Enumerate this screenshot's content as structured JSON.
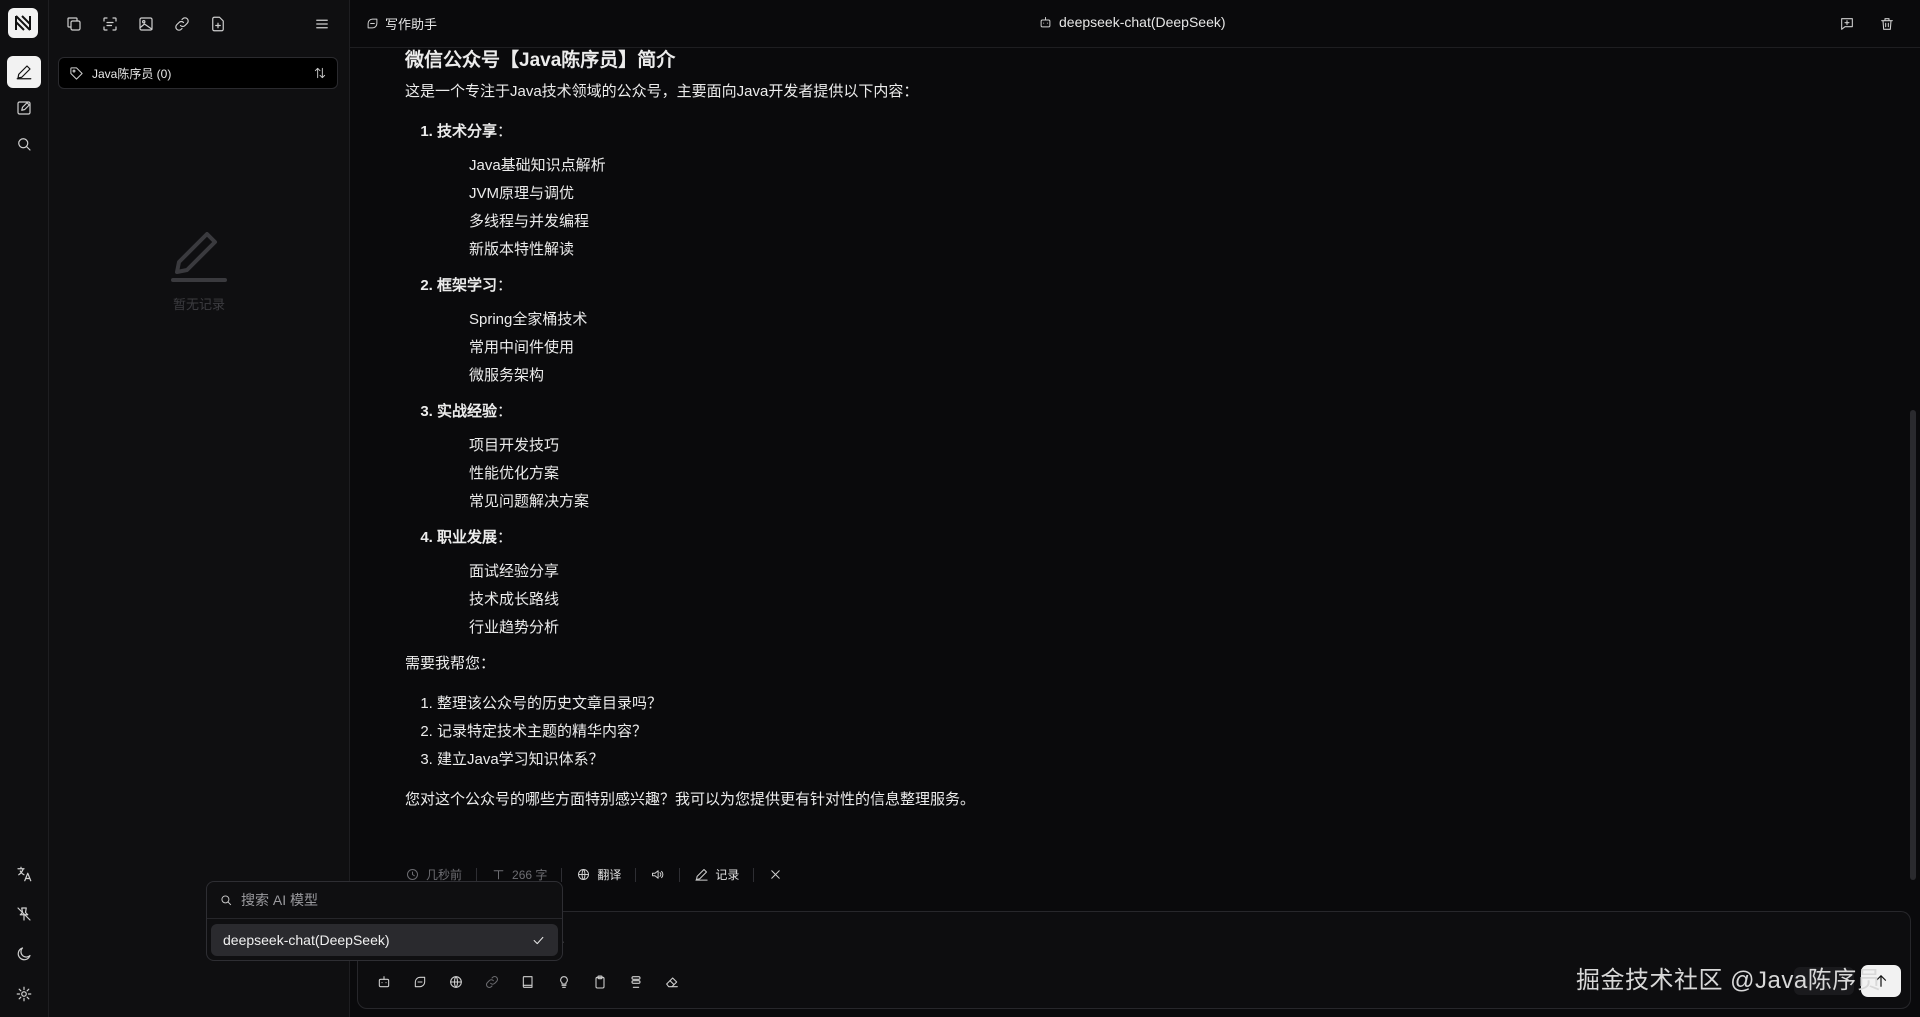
{
  "sidebar_tag": {
    "label": "Java陈序员 (0)"
  },
  "empty_state": {
    "text": "暂无记录"
  },
  "header": {
    "assistant_label": "写作助手",
    "model_label": "deepseek-chat(DeepSeek)"
  },
  "message": {
    "title": "微信公众号【Java陈序员】简介",
    "intro": "这是一个专注于Java技术领域的公众号，主要面向Java开发者提供以下内容：",
    "sections": [
      {
        "heading": "技术分享",
        "colon": "：",
        "items": [
          "Java基础知识点解析",
          "JVM原理与调优",
          "多线程与并发编程",
          "新版本特性解读"
        ]
      },
      {
        "heading": "框架学习",
        "colon": "：",
        "items": [
          "Spring全家桶技术",
          "常用中间件使用",
          "微服务架构"
        ]
      },
      {
        "heading": "实战经验",
        "colon": "：",
        "items": [
          "项目开发技巧",
          "性能优化方案",
          "常见问题解决方案"
        ]
      },
      {
        "heading": "职业发展",
        "colon": "：",
        "items": [
          "面试经验分享",
          "技术成长路线",
          "行业趋势分析"
        ]
      }
    ],
    "help_intro": "需要我帮您：",
    "asks": [
      "整理该公众号的历史文章目录吗？",
      "记录特定技术主题的精华内容？",
      "建立Java学习知识体系？"
    ],
    "closing": "您对这个公众号的哪些方面特别感兴趣？我可以为您提供更有针对性的信息整理服务。"
  },
  "meta": {
    "time": "几秒前",
    "word_count": "266 字",
    "translate": "翻译",
    "record": "记录"
  },
  "input": {
    "text": "...",
    "send_label": "发送"
  },
  "dropdown": {
    "search_placeholder": "搜索 AI 模型",
    "selected_option": "deepseek-chat(DeepSeek)"
  },
  "watermark": "掘金技术社区 @Java陈序员"
}
